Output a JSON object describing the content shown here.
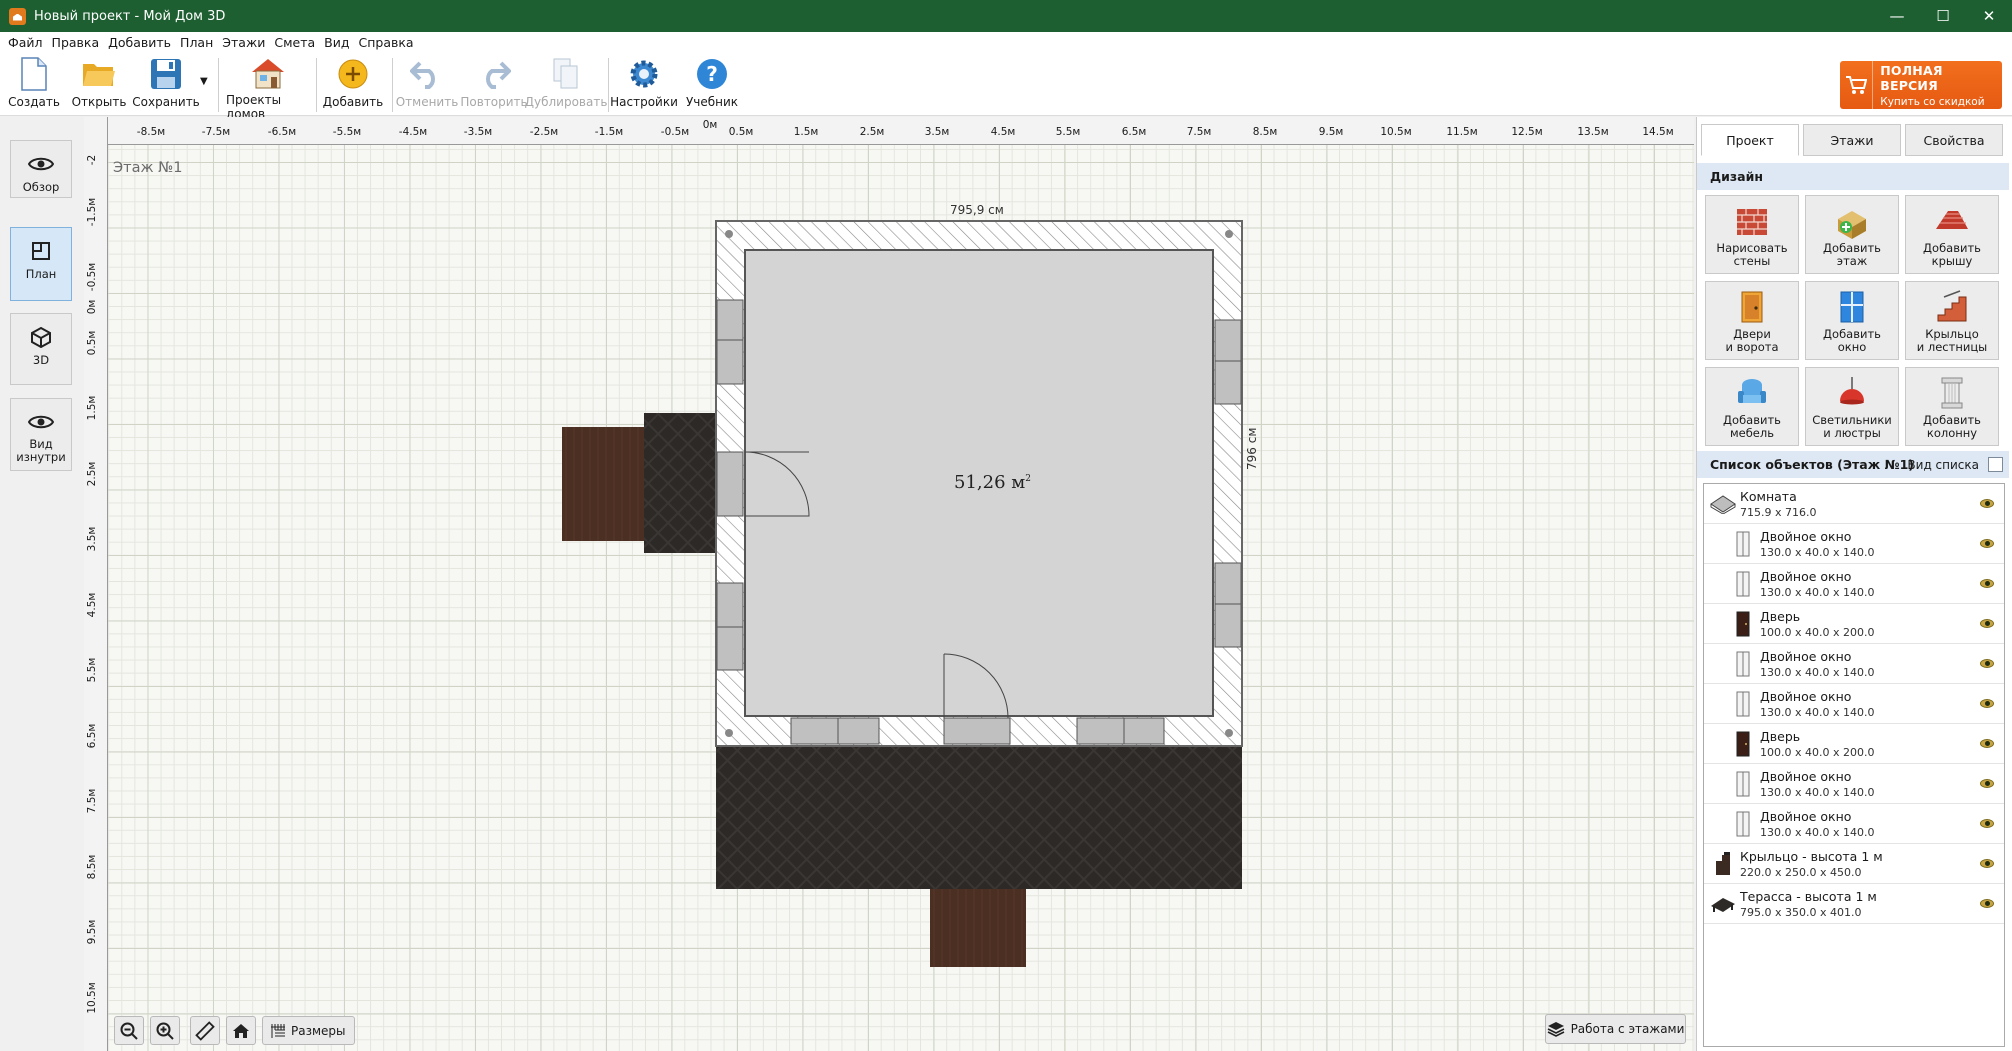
{
  "window": {
    "title": "Новый проект - Мой Дом 3D",
    "controls": [
      "minimize-icon",
      "maximize-icon",
      "close-icon"
    ]
  },
  "menu": [
    "Файл",
    "Правка",
    "Добавить",
    "План",
    "Этажи",
    "Смета",
    "Вид",
    "Справка"
  ],
  "toolbar": {
    "create": "Создать",
    "open": "Открыть",
    "save": "Сохранить",
    "projects": "Проекты домов",
    "add": "Добавить",
    "undo": "Отменить",
    "redo": "Повторить",
    "duplicate": "Дублировать",
    "settings": "Настройки",
    "tutorial": "Учебник"
  },
  "promo": {
    "title": "ПОЛНАЯ ВЕРСИЯ",
    "subtitle": "Купить со скидкой",
    "color": "#f0661a"
  },
  "leftnav": [
    {
      "label": "Обзор",
      "icon": "eye-icon",
      "active": false
    },
    {
      "label": "План",
      "icon": "plan-icon",
      "active": true
    },
    {
      "label": "3D",
      "icon": "cube-icon",
      "active": false
    },
    {
      "label": "Вид изнутри",
      "icon": "eye-icon",
      "active": false
    }
  ],
  "canvas": {
    "floor_label": "Этаж №1",
    "ruler_x": [
      "-8.5м",
      "-7.5м",
      "-6.5м",
      "-5.5м",
      "-4.5м",
      "-3.5м",
      "-2.5м",
      "-1.5м",
      "-0.5м",
      "0м",
      "0.5м",
      "1.5м",
      "2.5м",
      "3.5м",
      "4.5м",
      "5.5м",
      "6.5м",
      "7.5м",
      "8.5м",
      "9.5м",
      "10.5м",
      "11.5м",
      "12.5м",
      "13.5м",
      "14.5м"
    ],
    "ruler_y": [
      "-2",
      "-1.5м",
      "-0.5м",
      "0м",
      "0.5м",
      "1.5м",
      "2.5м",
      "3.5м",
      "4.5м",
      "5.5м",
      "6.5м",
      "7.5м",
      "8.5м",
      "9.5м",
      "10.5м"
    ],
    "width_dim": "795,9 см",
    "height_dim": "796 см",
    "area": "51,26 м",
    "area_sup": "2",
    "wall_color": "#999999",
    "floor_color": "#d4d4d4",
    "roof_color": "#3a3633",
    "wood_color": "#4a2f22"
  },
  "bottom_tools": {
    "sizes": "Размеры",
    "floors_button": "Работа с этажами"
  },
  "panel": {
    "tabs": [
      "Проект",
      "Этажи",
      "Свойства"
    ],
    "design_title": "Дизайн",
    "design": [
      {
        "l1": "Нарисовать",
        "l2": "стены",
        "icon": "brick-wall-icon"
      },
      {
        "l1": "Добавить",
        "l2": "этаж",
        "icon": "add-floor-icon"
      },
      {
        "l1": "Добавить",
        "l2": "крышу",
        "icon": "roof-icon"
      },
      {
        "l1": "Двери",
        "l2": "и ворота",
        "icon": "door-icon"
      },
      {
        "l1": "Добавить",
        "l2": "окно",
        "icon": "window-icon"
      },
      {
        "l1": "Крыльцо",
        "l2": "и лестницы",
        "icon": "stairs-icon"
      },
      {
        "l1": "Добавить",
        "l2": "мебель",
        "icon": "armchair-icon"
      },
      {
        "l1": "Светильники",
        "l2": "и люстры",
        "icon": "lamp-icon"
      },
      {
        "l1": "Добавить",
        "l2": "колонну",
        "icon": "column-icon"
      }
    ],
    "objects_title": "Список объектов (Этаж №1)",
    "list_view": "Вид списка",
    "objects": [
      {
        "name": "Комната",
        "size": "715.9 x 716.0",
        "icon": "room-icon",
        "sub": false
      },
      {
        "name": "Двойное окно",
        "size": "130.0 x 40.0 x 140.0",
        "icon": "window-icon",
        "sub": true
      },
      {
        "name": "Двойное окно",
        "size": "130.0 x 40.0 x 140.0",
        "icon": "window-icon",
        "sub": true
      },
      {
        "name": "Дверь",
        "size": "100.0 x 40.0 x 200.0",
        "icon": "door-icon",
        "sub": true
      },
      {
        "name": "Двойное окно",
        "size": "130.0 x 40.0 x 140.0",
        "icon": "window-icon",
        "sub": true
      },
      {
        "name": "Двойное окно",
        "size": "130.0 x 40.0 x 140.0",
        "icon": "window-icon",
        "sub": true
      },
      {
        "name": "Дверь",
        "size": "100.0 x 40.0 x 200.0",
        "icon": "door-icon",
        "sub": true
      },
      {
        "name": "Двойное окно",
        "size": "130.0 x 40.0 x 140.0",
        "icon": "window-icon",
        "sub": true
      },
      {
        "name": "Двойное окно",
        "size": "130.0 x 40.0 x 140.0",
        "icon": "window-icon",
        "sub": true
      },
      {
        "name": "Крыльцо - высота 1 м",
        "size": "220.0 x 250.0 x 450.0",
        "icon": "porch-icon",
        "sub": false
      },
      {
        "name": "Терасса - высота 1 м",
        "size": "795.0 x 350.0 x 401.0",
        "icon": "terrace-icon",
        "sub": false
      }
    ]
  }
}
